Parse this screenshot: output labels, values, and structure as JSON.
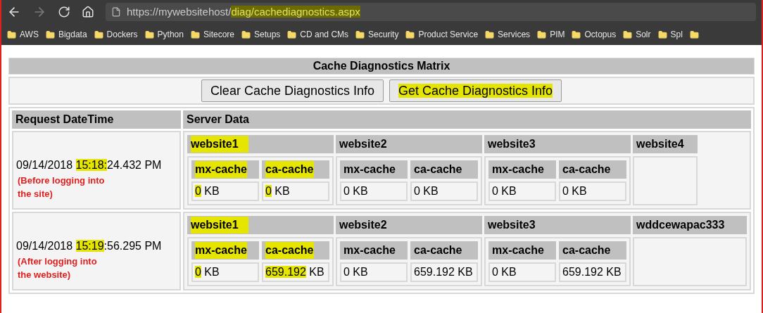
{
  "browser": {
    "url_host": "https://mywebsitehost/",
    "url_path": "diag/cachediagnostics.aspx",
    "url_path_highlighted": true,
    "forward_disabled": true,
    "bookmarks": [
      "AWS",
      "Bigdata",
      "Dockers",
      "Python",
      "Sitecore",
      "Setups",
      "CD and CMs",
      "Security",
      "Product Service",
      "Services",
      "PIM",
      "Octopus",
      "Solr",
      "Spl"
    ]
  },
  "page": {
    "title": "Cache Diagnostics Matrix",
    "buttons": [
      {
        "label": "Clear Cache Diagnostics Info",
        "highlighted": false
      },
      {
        "label": "Get Cache Diagnostics Info",
        "highlighted": true
      }
    ],
    "columns": [
      "Request DateTime",
      "Server Data"
    ],
    "rows": [
      {
        "datetime": [
          {
            "text": "09/14/2018 ",
            "highlighted": false
          },
          {
            "text": "15:18:",
            "highlighted": true
          },
          {
            "text": "24.432 PM",
            "highlighted": false
          }
        ],
        "note": "(Before logging into the site)",
        "servers": [
          {
            "name": "website1",
            "highlighted": true,
            "caches": [
              {
                "name": "mx-cache",
                "highlighted": true,
                "value": [
                  {
                    "text": "0",
                    "highlighted": true
                  },
                  {
                    "text": " KB",
                    "highlighted": false
                  }
                ]
              },
              {
                "name": "ca-cache",
                "highlighted": true,
                "value": [
                  {
                    "text": "0",
                    "highlighted": true
                  },
                  {
                    "text": " KB",
                    "highlighted": false
                  }
                ]
              }
            ]
          },
          {
            "name": "website2",
            "highlighted": false,
            "caches": [
              {
                "name": "mx-cache",
                "highlighted": false,
                "value": [
                  {
                    "text": "0 KB",
                    "highlighted": false
                  }
                ]
              },
              {
                "name": "ca-cache",
                "highlighted": false,
                "value": [
                  {
                    "text": "0 KB",
                    "highlighted": false
                  }
                ]
              }
            ]
          },
          {
            "name": "website3",
            "highlighted": false,
            "caches": [
              {
                "name": "mx-cache",
                "highlighted": false,
                "value": [
                  {
                    "text": "0 KB",
                    "highlighted": false
                  }
                ]
              },
              {
                "name": "ca-cache",
                "highlighted": false,
                "value": [
                  {
                    "text": "0 KB",
                    "highlighted": false
                  }
                ]
              }
            ]
          },
          {
            "name": "website4",
            "highlighted": false
          }
        ]
      },
      {
        "datetime": [
          {
            "text": "09/14/2018 ",
            "highlighted": false
          },
          {
            "text": "15:19",
            "highlighted": true
          },
          {
            "text": ":56.295 PM",
            "highlighted": false
          }
        ],
        "note": "(After logging into the website)",
        "servers": [
          {
            "name": "website1",
            "highlighted": true,
            "caches": [
              {
                "name": "mx-cache",
                "highlighted": true,
                "value": [
                  {
                    "text": "0",
                    "highlighted": true
                  },
                  {
                    "text": " KB",
                    "highlighted": false
                  }
                ]
              },
              {
                "name": "ca-cache",
                "highlighted": true,
                "value": [
                  {
                    "text": "659.192",
                    "highlighted": true
                  },
                  {
                    "text": " KB",
                    "highlighted": false
                  }
                ]
              }
            ]
          },
          {
            "name": "website2",
            "highlighted": false,
            "caches": [
              {
                "name": "mx-cache",
                "highlighted": false,
                "value": [
                  {
                    "text": "0 KB",
                    "highlighted": false
                  }
                ]
              },
              {
                "name": "ca-cache",
                "highlighted": false,
                "value": [
                  {
                    "text": "659.192 KB",
                    "highlighted": false
                  }
                ]
              }
            ]
          },
          {
            "name": "website3",
            "highlighted": false,
            "caches": [
              {
                "name": "mx-cache",
                "highlighted": false,
                "value": [
                  {
                    "text": "0 KB",
                    "highlighted": false
                  }
                ]
              },
              {
                "name": "ca-cache",
                "highlighted": false,
                "value": [
                  {
                    "text": "659.192 KB",
                    "highlighted": false
                  }
                ]
              }
            ]
          },
          {
            "name": "wddcewapac333",
            "highlighted": false
          }
        ]
      }
    ]
  }
}
